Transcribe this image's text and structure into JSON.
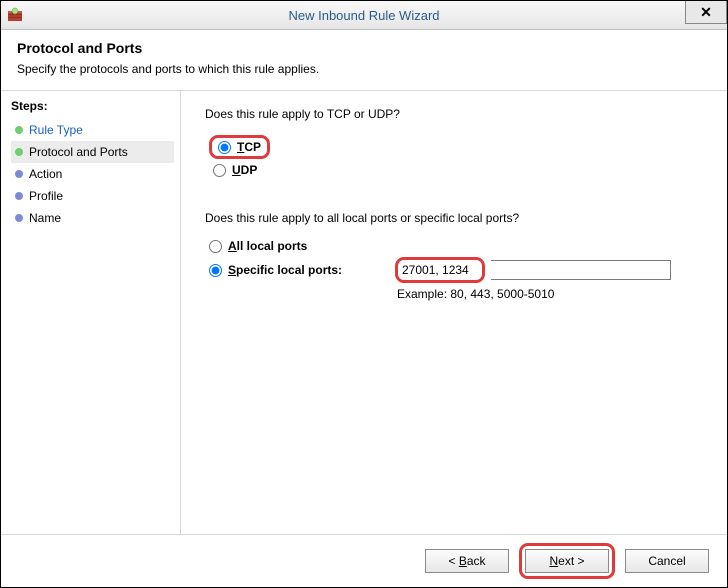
{
  "window": {
    "title": "New Inbound Rule Wizard"
  },
  "header": {
    "title": "Protocol and Ports",
    "description": "Specify the protocols and ports to which this rule applies."
  },
  "sidebar": {
    "stepsLabel": "Steps:",
    "items": [
      {
        "label": "Rule Type",
        "state": "done"
      },
      {
        "label": "Protocol and Ports",
        "state": "current"
      },
      {
        "label": "Action",
        "state": "future"
      },
      {
        "label": "Profile",
        "state": "future"
      },
      {
        "label": "Name",
        "state": "future"
      }
    ]
  },
  "content": {
    "q1": "Does this rule apply to TCP or UDP?",
    "tcpLabel": "TCP",
    "udpLabel": "UDP",
    "protocolSelected": "tcp",
    "q2": "Does this rule apply to all local ports or specific local ports?",
    "allPortsLabel": "All local ports",
    "specificPortsLabel": "Specific local ports:",
    "portScopeSelected": "specific",
    "portsValue": "27001, 1234",
    "exampleLabel": "Example: 80, 443, 5000-5010"
  },
  "footer": {
    "back": "< Back",
    "next": "Next >",
    "cancel": "Cancel"
  }
}
